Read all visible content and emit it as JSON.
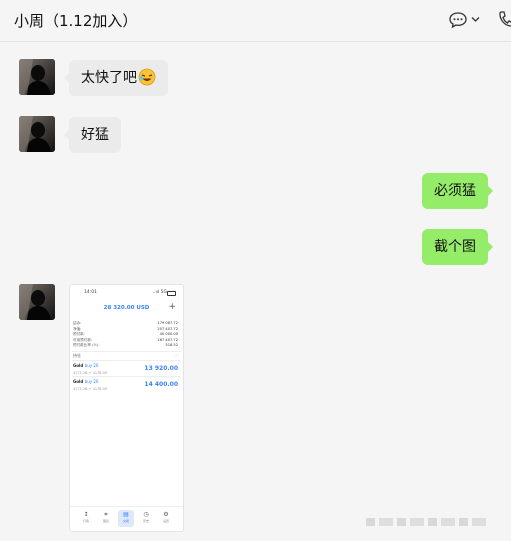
{
  "header": {
    "title": "小周（1.12加入）",
    "chat_icon": "chat-bubble-icon",
    "dropdown_icon": "chevron-down-icon",
    "call_icon": "phone-icon"
  },
  "messages": [
    {
      "side": "in",
      "text": "太快了吧",
      "emoji": "laughing-emoji"
    },
    {
      "side": "in",
      "text": "好猛"
    },
    {
      "side": "out",
      "text": "必须猛"
    },
    {
      "side": "out",
      "text": "截个图"
    },
    {
      "side": "in",
      "type": "image"
    }
  ],
  "screenshot": {
    "time": "14:01",
    "signal": "..ııl 5G",
    "balance": "28 320.00 USD",
    "plus": "+",
    "rows": [
      {
        "label": "结余:",
        "value": "179 087.72"
      },
      {
        "label": "净值:",
        "value": "207 407.72"
      },
      {
        "label": "预付款:",
        "value": "40 000.00"
      },
      {
        "label": "可用预付款:",
        "value": "167 407.72"
      },
      {
        "label": "预付款比率 (%):",
        "value": "518.52"
      }
    ],
    "positions_label": "持仓",
    "positions_more": "...",
    "orders": [
      {
        "symbol": "Gold",
        "tag": "buy 20",
        "prices": "4171.28 → 4178.00",
        "profit": "13 920.00"
      },
      {
        "symbol": "Gold",
        "tag": "buy 20",
        "prices": "4171.28 → 4178.00",
        "profit": "14 400.00"
      }
    ],
    "tabs": [
      {
        "icon": "↕",
        "label": "行情"
      },
      {
        "icon": "⌗",
        "label": "图表"
      },
      {
        "icon": "▤",
        "label": "交易"
      },
      {
        "icon": "◷",
        "label": "历史"
      },
      {
        "icon": "⚙",
        "label": "设置"
      }
    ]
  },
  "watermark": "@"
}
